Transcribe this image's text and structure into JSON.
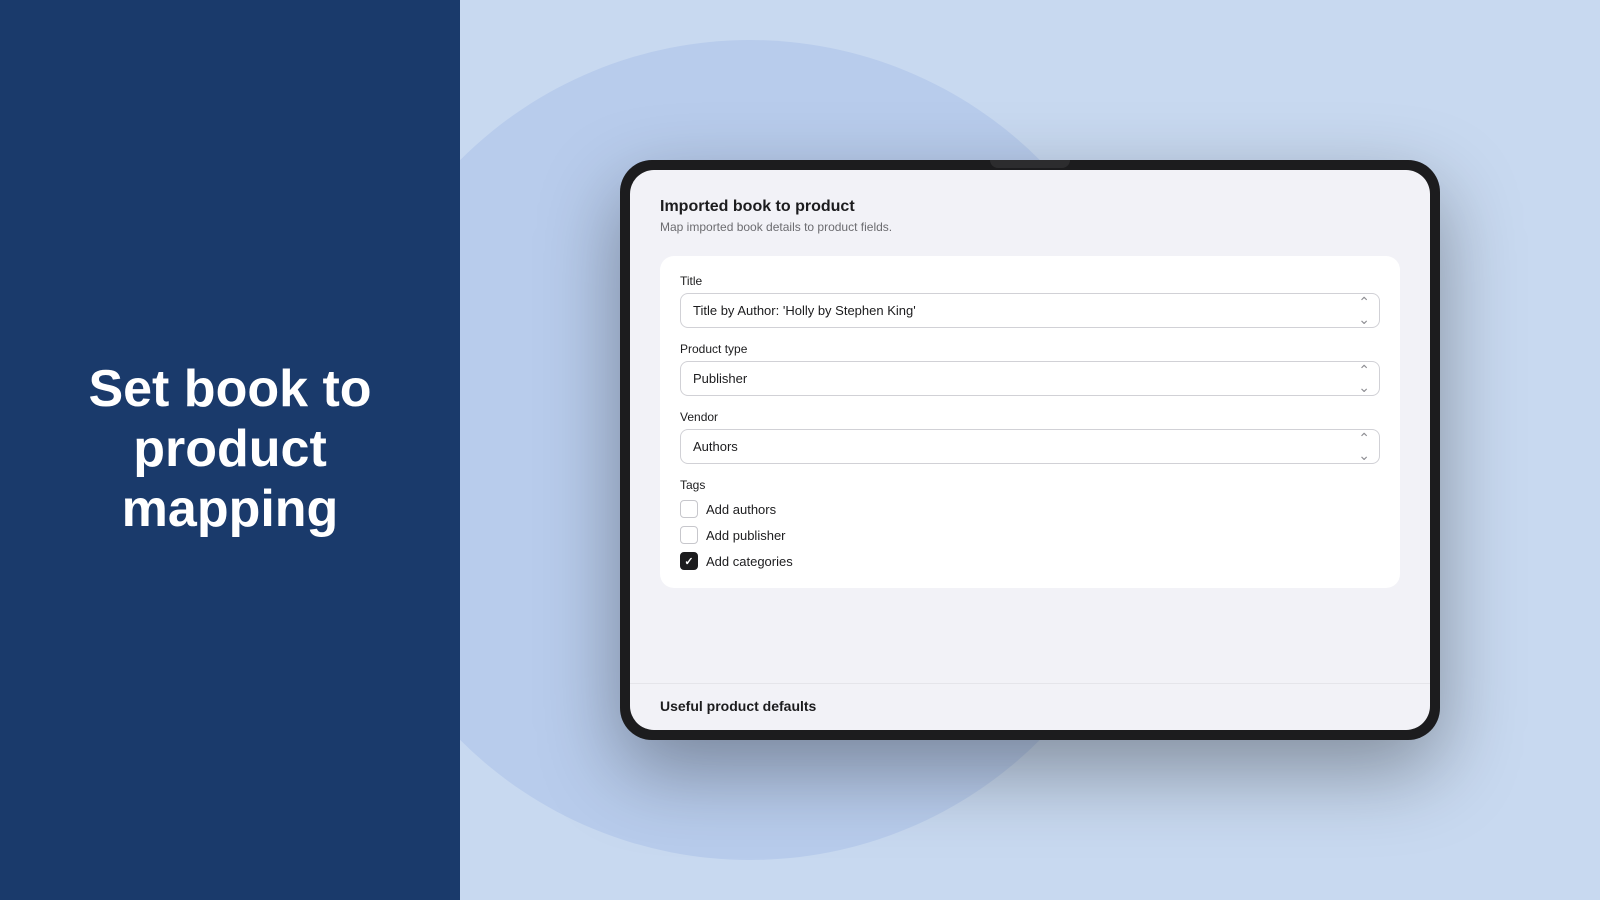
{
  "left": {
    "title": "Set book to product mapping"
  },
  "right": {
    "tablet": {
      "form": {
        "title": "Imported book to product",
        "subtitle": "Map imported book details to product fields.",
        "title_field": {
          "label": "Title",
          "value": "Title by Author: 'Holly by Stephen King'"
        },
        "product_type_field": {
          "label": "Product type",
          "value": "Publisher"
        },
        "vendor_field": {
          "label": "Vendor",
          "value": "Authors"
        },
        "tags_section": {
          "label": "Tags",
          "checkboxes": [
            {
              "id": "add-authors",
              "label": "Add authors",
              "checked": false
            },
            {
              "id": "add-publisher",
              "label": "Add publisher",
              "checked": false
            },
            {
              "id": "add-categories",
              "label": "Add categories",
              "checked": true
            }
          ]
        }
      },
      "bottom": {
        "title": "Useful product defaults"
      }
    }
  }
}
